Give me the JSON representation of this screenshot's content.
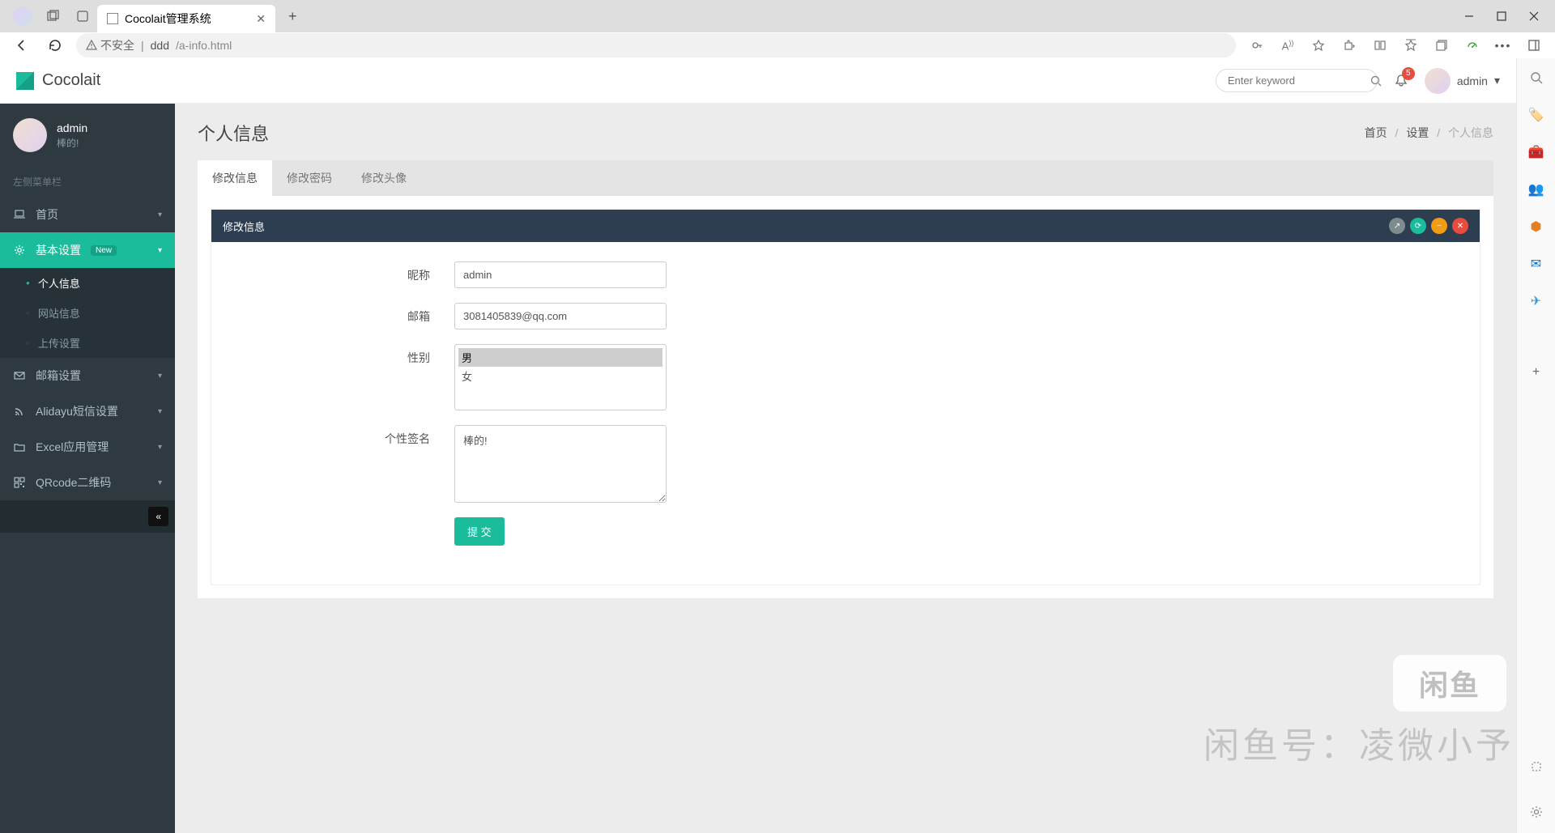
{
  "browser": {
    "tab_title": "Cocolait管理系统",
    "insecure_label": "不安全",
    "url_host": "ddd",
    "url_path": "/a-info.html"
  },
  "topbar": {
    "brand": "Cocolait",
    "search_placeholder": "Enter keyword",
    "notification_count": "5",
    "username": "admin"
  },
  "sidebar": {
    "user_name": "admin",
    "user_signature": "棒的!",
    "section_label": "左侧菜单栏",
    "items": [
      {
        "icon": "laptop",
        "label": "首页",
        "has_children": true
      },
      {
        "icon": "gear",
        "label": "基本设置",
        "badge": "New",
        "active": true,
        "has_children": true,
        "children": [
          {
            "label": "个人信息",
            "active": true
          },
          {
            "label": "网站信息"
          },
          {
            "label": "上传设置"
          }
        ]
      },
      {
        "icon": "envelope",
        "label": "邮箱设置",
        "has_children": true
      },
      {
        "icon": "rss",
        "label": "Alidayu短信设置",
        "has_children": true
      },
      {
        "icon": "folder",
        "label": "Excel应用管理",
        "has_children": true
      },
      {
        "icon": "qrcode",
        "label": "QRcode二维码",
        "has_children": true
      }
    ]
  },
  "page": {
    "title": "个人信息",
    "breadcrumb": {
      "home": "首页",
      "mid": "设置",
      "current": "个人信息"
    },
    "tabs": [
      {
        "label": "修改信息",
        "active": true
      },
      {
        "label": "修改密码"
      },
      {
        "label": "修改头像"
      }
    ],
    "box_title": "修改信息",
    "form": {
      "nickname_label": "昵称",
      "nickname_value": "admin",
      "email_label": "邮箱",
      "email_value": "3081405839@qq.com",
      "gender_label": "性别",
      "gender_options": [
        "男",
        "女"
      ],
      "gender_selected": "男",
      "signature_label": "个性签名",
      "signature_value": "棒的!",
      "submit_label": "提 交"
    }
  },
  "watermark": {
    "logo_text": "闲鱼",
    "line": "闲鱼号：凌微小予"
  }
}
